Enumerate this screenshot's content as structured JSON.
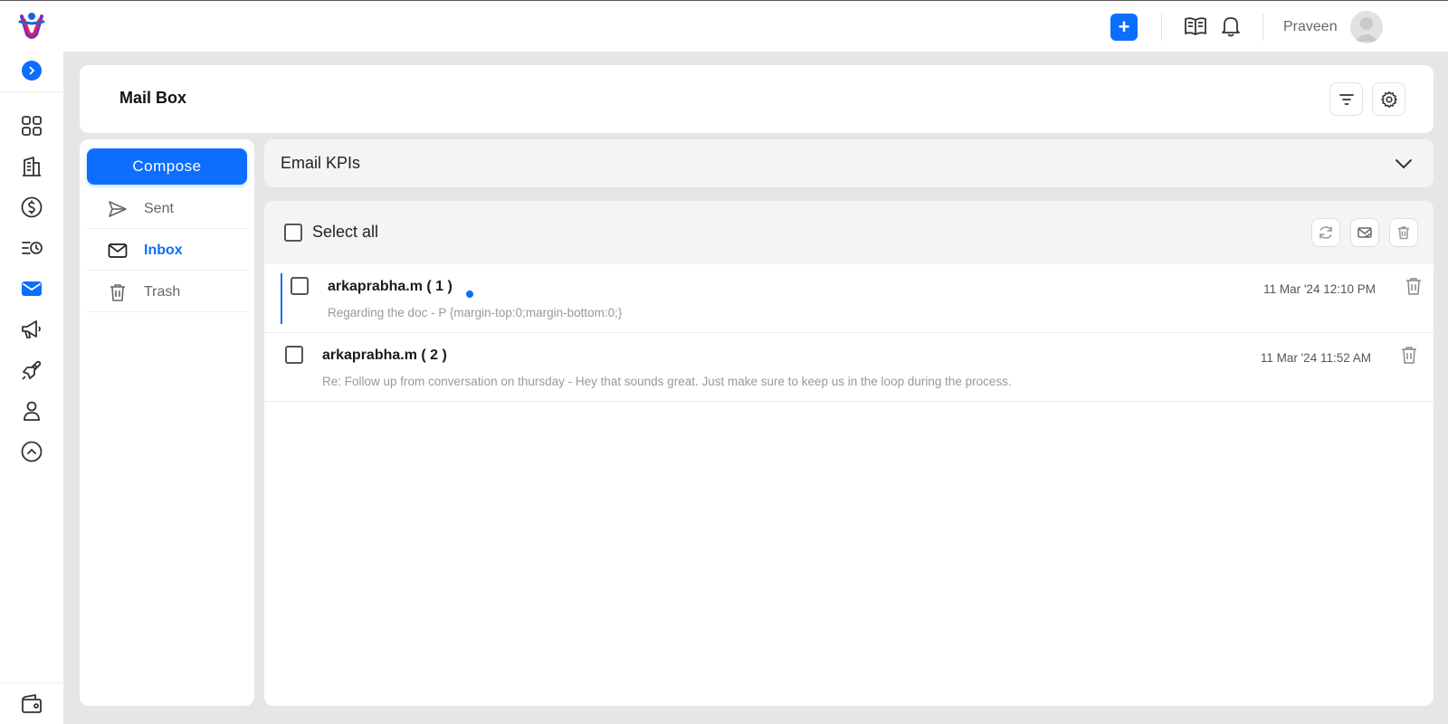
{
  "topbar": {
    "add_label": "+",
    "username": "Praveen",
    "icons": [
      "app-logo",
      "plus-icon",
      "book-icon",
      "bell-icon",
      "user-avatar"
    ]
  },
  "rail": {
    "items": [
      "dashboard-grid-icon",
      "building-icon",
      "dollar-icon",
      "schedule-list-icon",
      "mail-icon",
      "megaphone-icon",
      "rocket-icon",
      "user-icon",
      "chevron-up-circle-icon",
      "wallet-icon"
    ],
    "active": "mail-icon"
  },
  "header": {
    "title": "Mail Box"
  },
  "folders": {
    "compose_label": "Compose",
    "items": [
      {
        "label": "Sent",
        "icon": "send-icon"
      },
      {
        "label": "Inbox",
        "icon": "inbox-icon"
      },
      {
        "label": "Trash",
        "icon": "trash-icon"
      }
    ],
    "active": "Inbox"
  },
  "kpi": {
    "title": "Email KPIs"
  },
  "list": {
    "select_all_label": "Select all",
    "emails": [
      {
        "sender": "arkaprabha.m ( 1 )",
        "preview": "Regarding the doc -  P {margin-top:0;margin-bottom:0;}",
        "date": "11 Mar '24 12:10 PM",
        "unread": true
      },
      {
        "sender": "arkaprabha.m ( 2 )",
        "preview": "Re: Follow up from conversation on thursday -  Hey that sounds great. Just make sure to keep us in the loop during the process.",
        "date": "11 Mar '24 11:52 AM",
        "unread": false
      }
    ]
  },
  "colors": {
    "accent": "#0d6efd",
    "background": "#e6e6e6",
    "panel": "#ffffff",
    "muted_panel": "#f4f4f4"
  }
}
